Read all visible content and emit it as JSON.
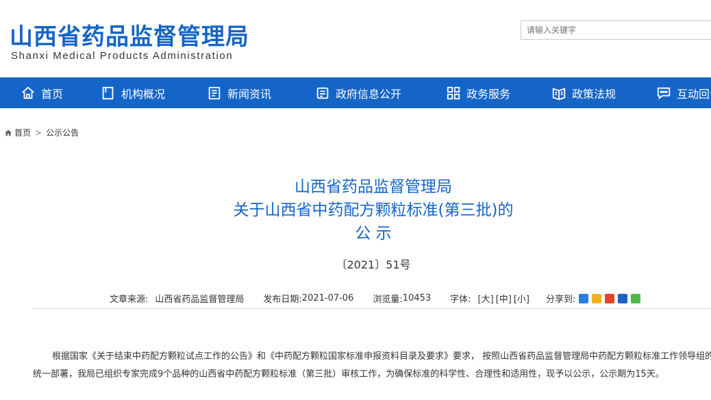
{
  "header": {
    "logo_cn": "山西省药品监督管理局",
    "logo_en": "Shanxi Medical Products Administration",
    "search_placeholder": "请输入关键字"
  },
  "nav": {
    "items": [
      {
        "label": "首页",
        "icon": "home-icon"
      },
      {
        "label": "机构概况",
        "icon": "document-icon"
      },
      {
        "label": "新闻资讯",
        "icon": "news-icon"
      },
      {
        "label": "政府信息公开",
        "icon": "list-icon"
      },
      {
        "label": "政务服务",
        "icon": "grid-icon"
      },
      {
        "label": "政策法规",
        "icon": "book-icon"
      },
      {
        "label": "互动回",
        "icon": "chat-icon"
      }
    ]
  },
  "breadcrumb": {
    "home": "首页",
    "sep": ">",
    "current": "公示公告"
  },
  "article": {
    "title_line1": "山西省药品监督管理局",
    "title_line2": "关于山西省中药配方颗粒标准(第三批)的",
    "title_line3": "公 示",
    "doc_number": "〔2021〕51号",
    "source_label": "文章来源:",
    "source": "山西省药品监督管理局",
    "date_label": "发布日期:",
    "date": "2021-07-06",
    "views_label": "浏览量:",
    "views": "10453",
    "font_label": "字体:",
    "font_large": "[大]",
    "font_medium": "[中]",
    "font_small": "[小]",
    "share_label": "分享到:",
    "paragraph1": "根据国家《关于结束中药配方颗粒试点工作的公告》和《中药配方颗粒国家标准申报资料目录及要求》要求， 按照山西省药品监督管理局中药配方颗粒标准工作领导组的统一部署，我局已组织专家完成9个品种的山西省中药配方颗粒标准（第三批）审核工作，为确保标准的科学性、合理性和适用性，现予以公示，公示期为15天。"
  },
  "colors": {
    "brand_blue": "#1565c8",
    "text": "#333333"
  }
}
